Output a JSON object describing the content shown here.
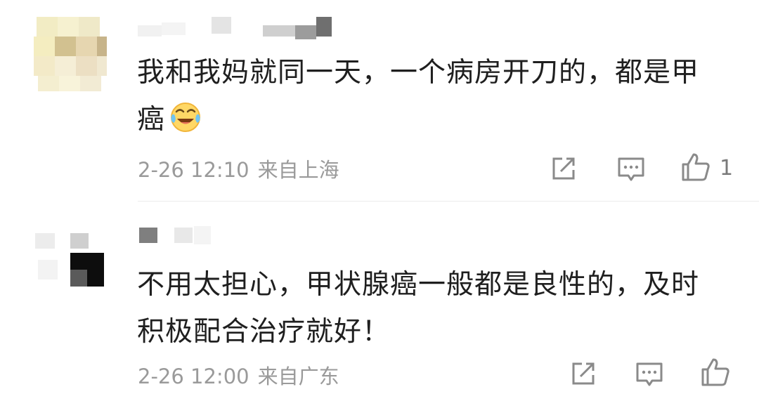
{
  "comments": [
    {
      "text_line1": "我和我妈就同一天，一个病房开刀的，都是甲",
      "text_line2": "癌",
      "emoji": "laughing-crying-emoji",
      "date": "2-26 12:10",
      "location": "来自上海",
      "like_count": "1",
      "actions": [
        "share-icon",
        "comment-icon",
        "like-icon"
      ]
    },
    {
      "text_line1": "不用太担心，甲状腺癌一般都是良性的，及时",
      "text_line2": "积极配合治疗就好！",
      "date": "2-26 12:00",
      "location": "来自广东",
      "actions": [
        "share-icon",
        "comment-icon",
        "like-icon"
      ]
    }
  ],
  "colors": {
    "text": "#1f1f1f",
    "meta": "#9a9a9a",
    "icon": "#8a8a8a",
    "divider": "#ececec"
  }
}
